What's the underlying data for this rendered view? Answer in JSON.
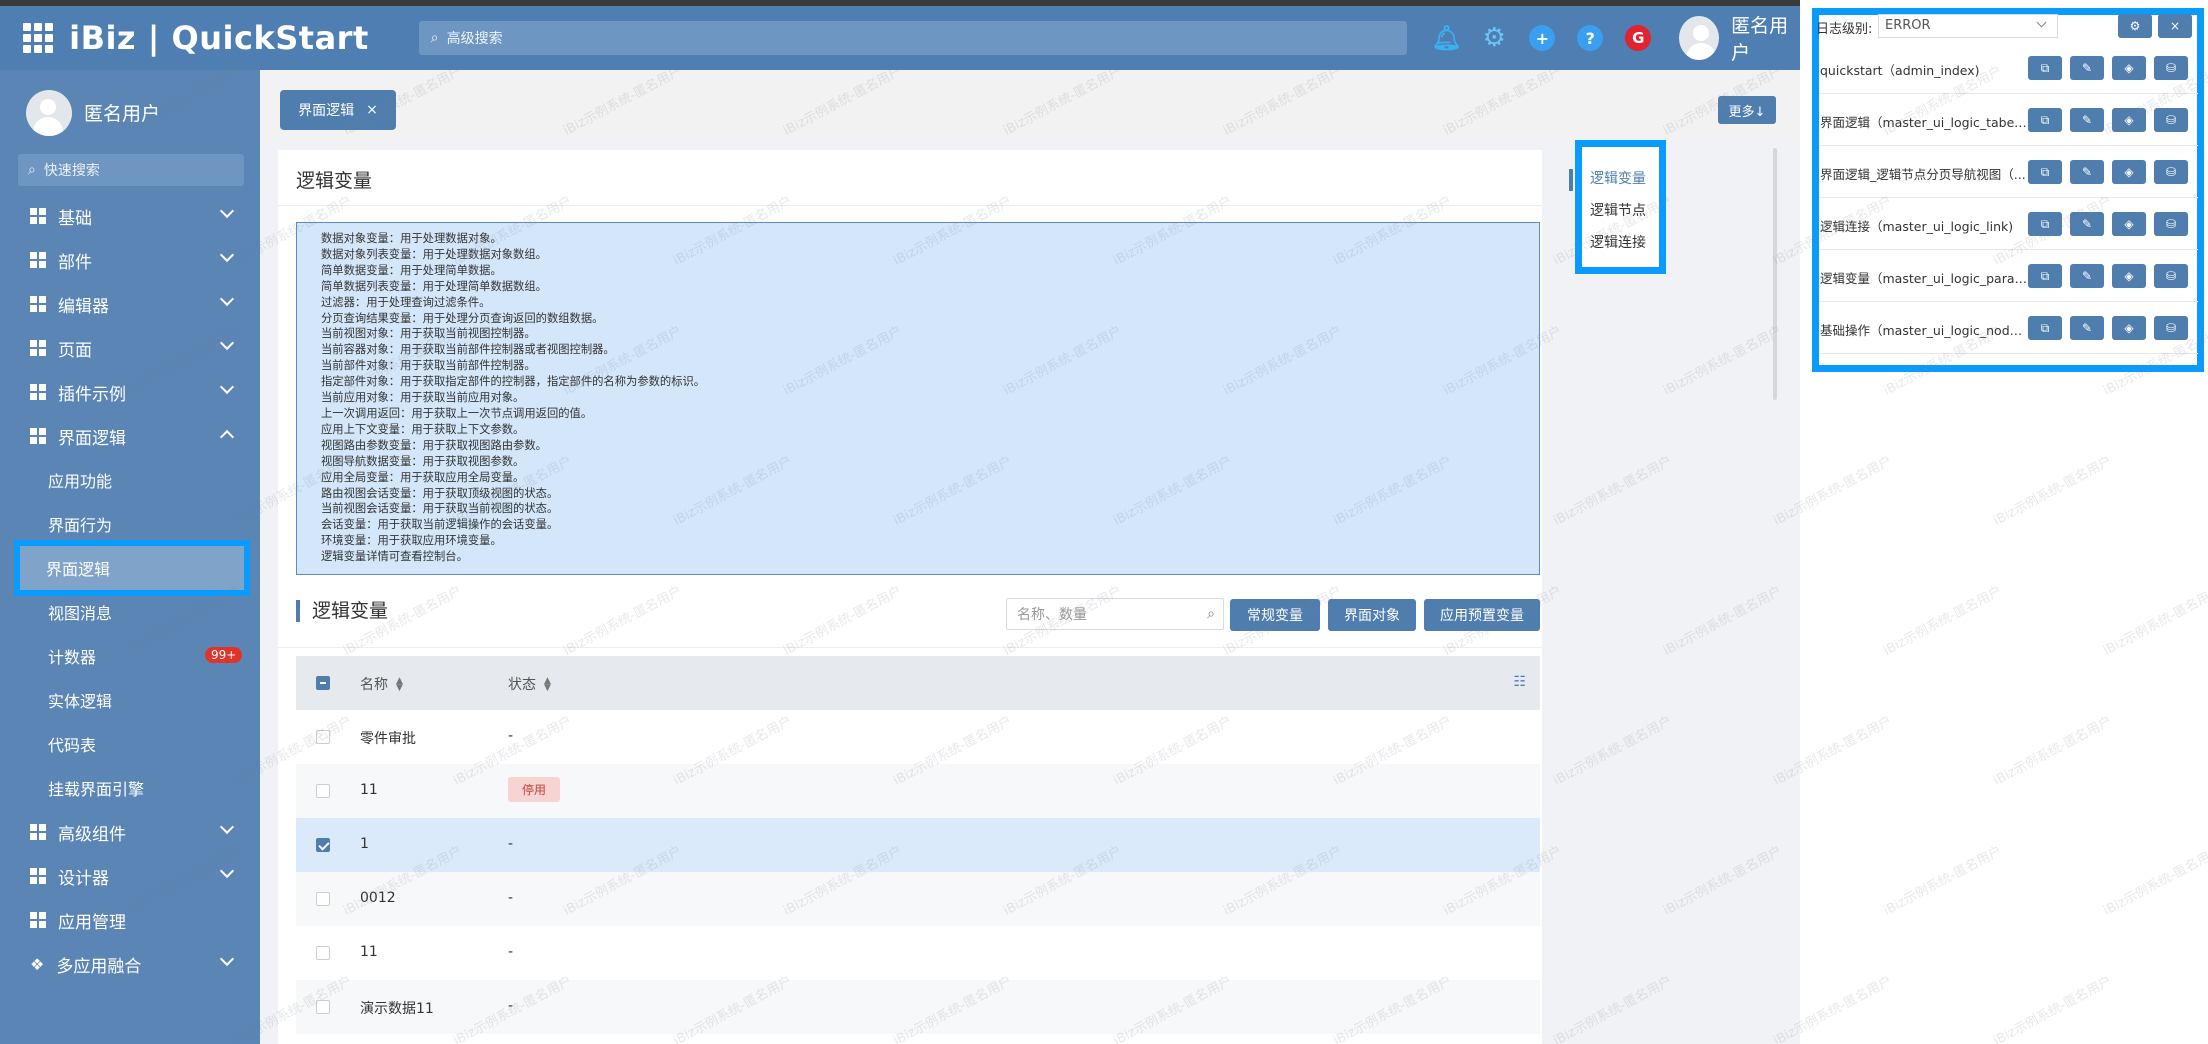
{
  "header": {
    "brand": "iBiz | QuickStart",
    "search_placeholder": "高级搜索",
    "user_name": "匿名用户",
    "g_badge": "G"
  },
  "sidebar": {
    "user_name": "匿名用户",
    "quick_search": "快速搜索",
    "groups_top": [
      {
        "label": "基础"
      },
      {
        "label": "部件"
      },
      {
        "label": "编辑器"
      },
      {
        "label": "页面"
      },
      {
        "label": "插件示例"
      },
      {
        "label": "界面逻辑"
      }
    ],
    "sub_items": [
      "应用功能",
      "界面行为",
      "界面逻辑",
      "视图消息",
      "计数器",
      "实体逻辑",
      "代码表",
      "挂载界面引擎"
    ],
    "counter_badge": "99+",
    "groups_bottom": [
      {
        "label": "高级组件"
      },
      {
        "label": "设计器"
      },
      {
        "label": "应用管理"
      },
      {
        "label": "多应用融合"
      }
    ]
  },
  "tabs": {
    "active_label": "界面逻辑",
    "close": "×",
    "more": "更多↓"
  },
  "main": {
    "title": "逻辑变量",
    "info_lines": [
      "数据对象变量：用于处理数据对象。",
      "数据对象列表变量：用于处理数据对象数组。",
      "简单数据变量：用于处理简单数据。",
      "简单数据列表变量：用于处理简单数据数组。",
      "过滤器：用于处理查询过滤条件。",
      "分页查询结果变量：用于处理分页查询返回的数组数据。",
      "当前视图对象：用于获取当前视图控制器。",
      "当前容器对象：用于获取当前部件控制器或者视图控制器。",
      "当前部件对象：用于获取当前部件控制器。",
      "指定部件对象：用于获取指定部件的控制器，指定部件的名称为参数的标识。",
      "当前应用对象：用于获取当前应用对象。",
      "上一次调用返回：用于获取上一次节点调用返回的值。",
      "应用上下文变量：用于获取上下文参数。",
      "视图路由参数变量：用于获取视图路由参数。",
      "视图导航数据变量：用于获取视图参数。",
      "应用全局变量：用于获取应用全局变量。",
      "路由视图会话变量：用于获取顶级视图的状态。",
      "当前视图会话变量：用于获取当前视图的状态。",
      "会话变量：用于获取当前逻辑操作的会话变量。",
      "环境变量：用于获取应用环境变量。",
      "逻辑变量详情可查看控制台。"
    ],
    "section_title": "逻辑变量",
    "search_placeholder": "名称、数量",
    "buttons": [
      "常规变量",
      "界面对象",
      "应用预置变量"
    ],
    "columns": [
      "名称",
      "状态"
    ],
    "rows": [
      {
        "name": "零件审批",
        "status": "-"
      },
      {
        "name": "11",
        "status": "停用"
      },
      {
        "name": "1",
        "status": "-"
      },
      {
        "name": "0012",
        "status": "-"
      },
      {
        "name": "11",
        "status": "-"
      },
      {
        "name": "演示数据11",
        "status": "-"
      }
    ]
  },
  "anchor": {
    "items": [
      "逻辑变量",
      "逻辑节点",
      "逻辑连接"
    ]
  },
  "debug_panel": {
    "log_level_label": "日志级别:",
    "log_level_value": "ERROR",
    "gear": "⚙",
    "close": "×",
    "rows": [
      "quickstart（admin_index)",
      "界面逻辑（master_ui_logic_tabexp...",
      "界面逻辑_逻辑节点分页导航视图（...",
      "逻辑连接（master_ui_logic_link)",
      "逻辑变量（master_ui_logic_params...",
      "基础操作（master_ui_logic_node_b..."
    ]
  },
  "watermark": "iBiz示例系统-匿名用户",
  "colors": {
    "header": "#4e7eb2",
    "sidebar": "#5a85b5",
    "primary": "#4f7eae",
    "highlight": "#0a9bff",
    "info_bg": "#d4e6fa",
    "tag_bg": "#f7d3d1"
  }
}
